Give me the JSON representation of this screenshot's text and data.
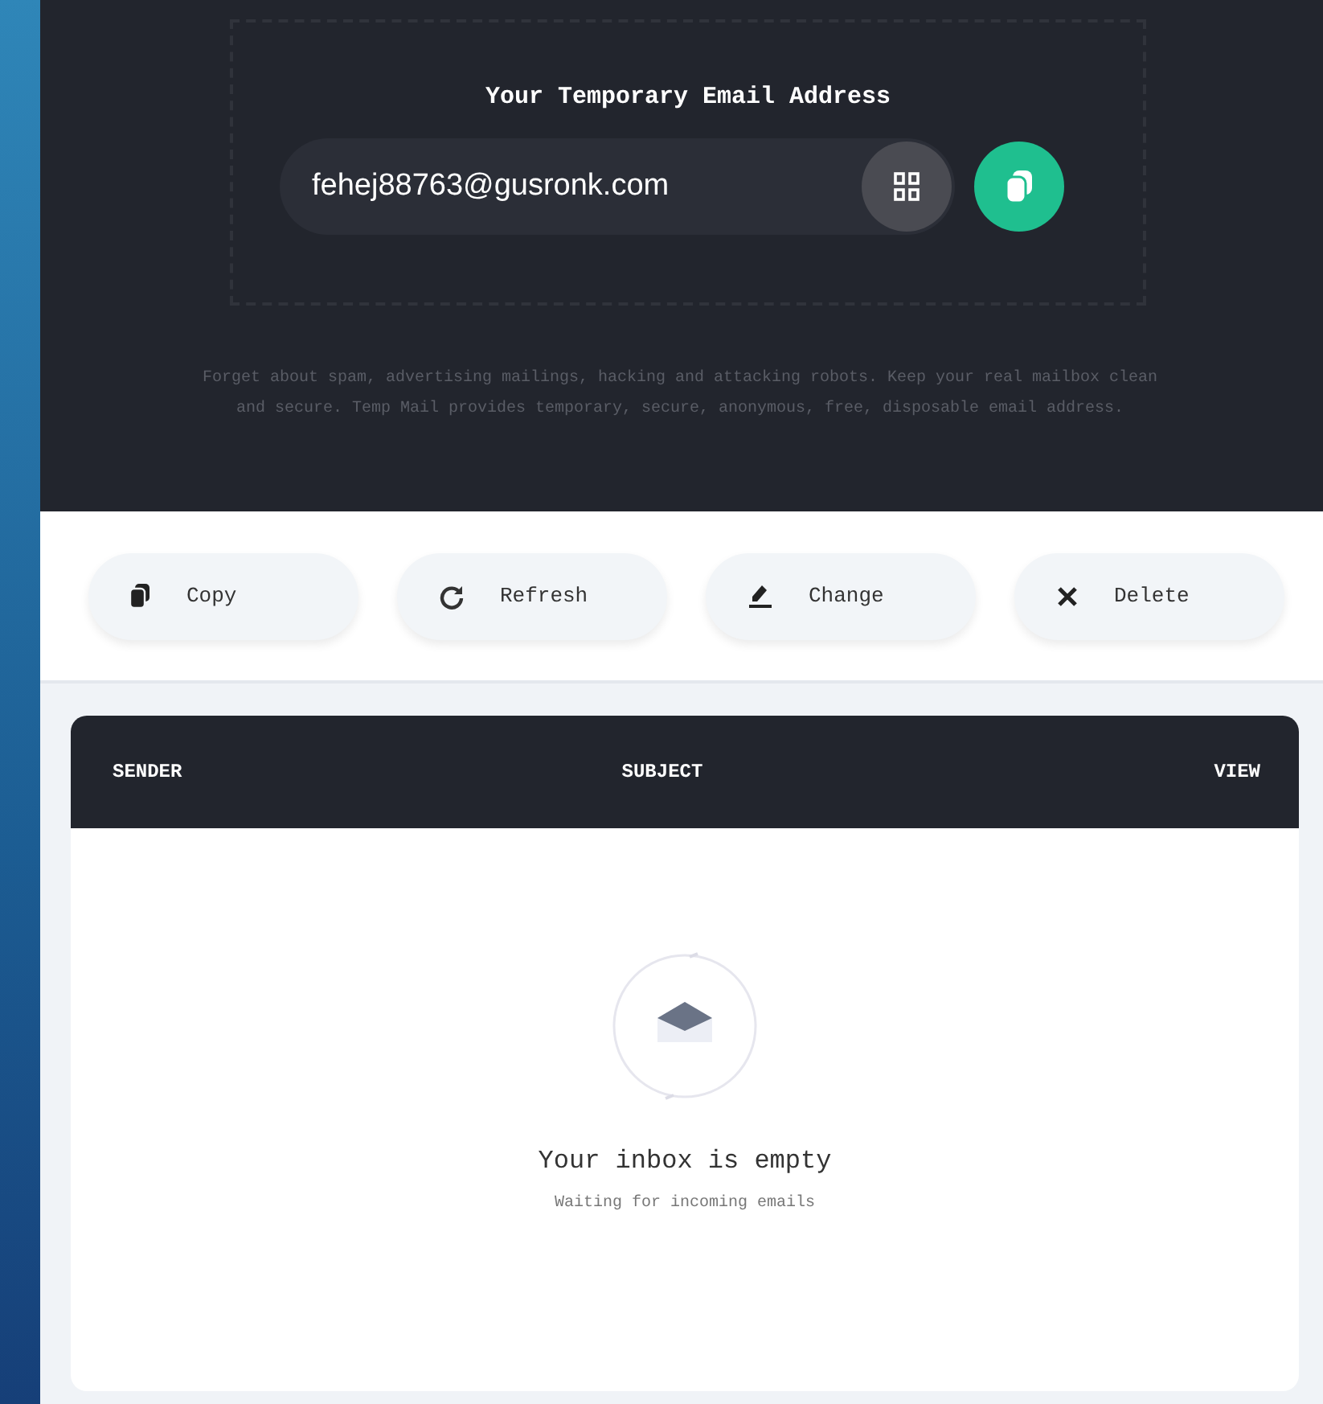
{
  "header": {
    "title": "Your Temporary Email Address",
    "email": "fehej88763@gusronk.com",
    "description": "Forget about spam, advertising mailings, hacking and attacking robots. Keep your real mailbox clean and secure. Temp Mail provides temporary, secure, anonymous, free, disposable email address."
  },
  "actions": [
    {
      "kind": "copy",
      "label": "Copy"
    },
    {
      "kind": "refresh",
      "label": "Refresh"
    },
    {
      "kind": "change",
      "label": "Change"
    },
    {
      "kind": "delete",
      "label": "Delete"
    }
  ],
  "inbox": {
    "columns": [
      "SENDER",
      "SUBJECT",
      "VIEW"
    ],
    "empty_title": "Your inbox is empty",
    "empty_subtitle": "Waiting for incoming emails"
  }
}
